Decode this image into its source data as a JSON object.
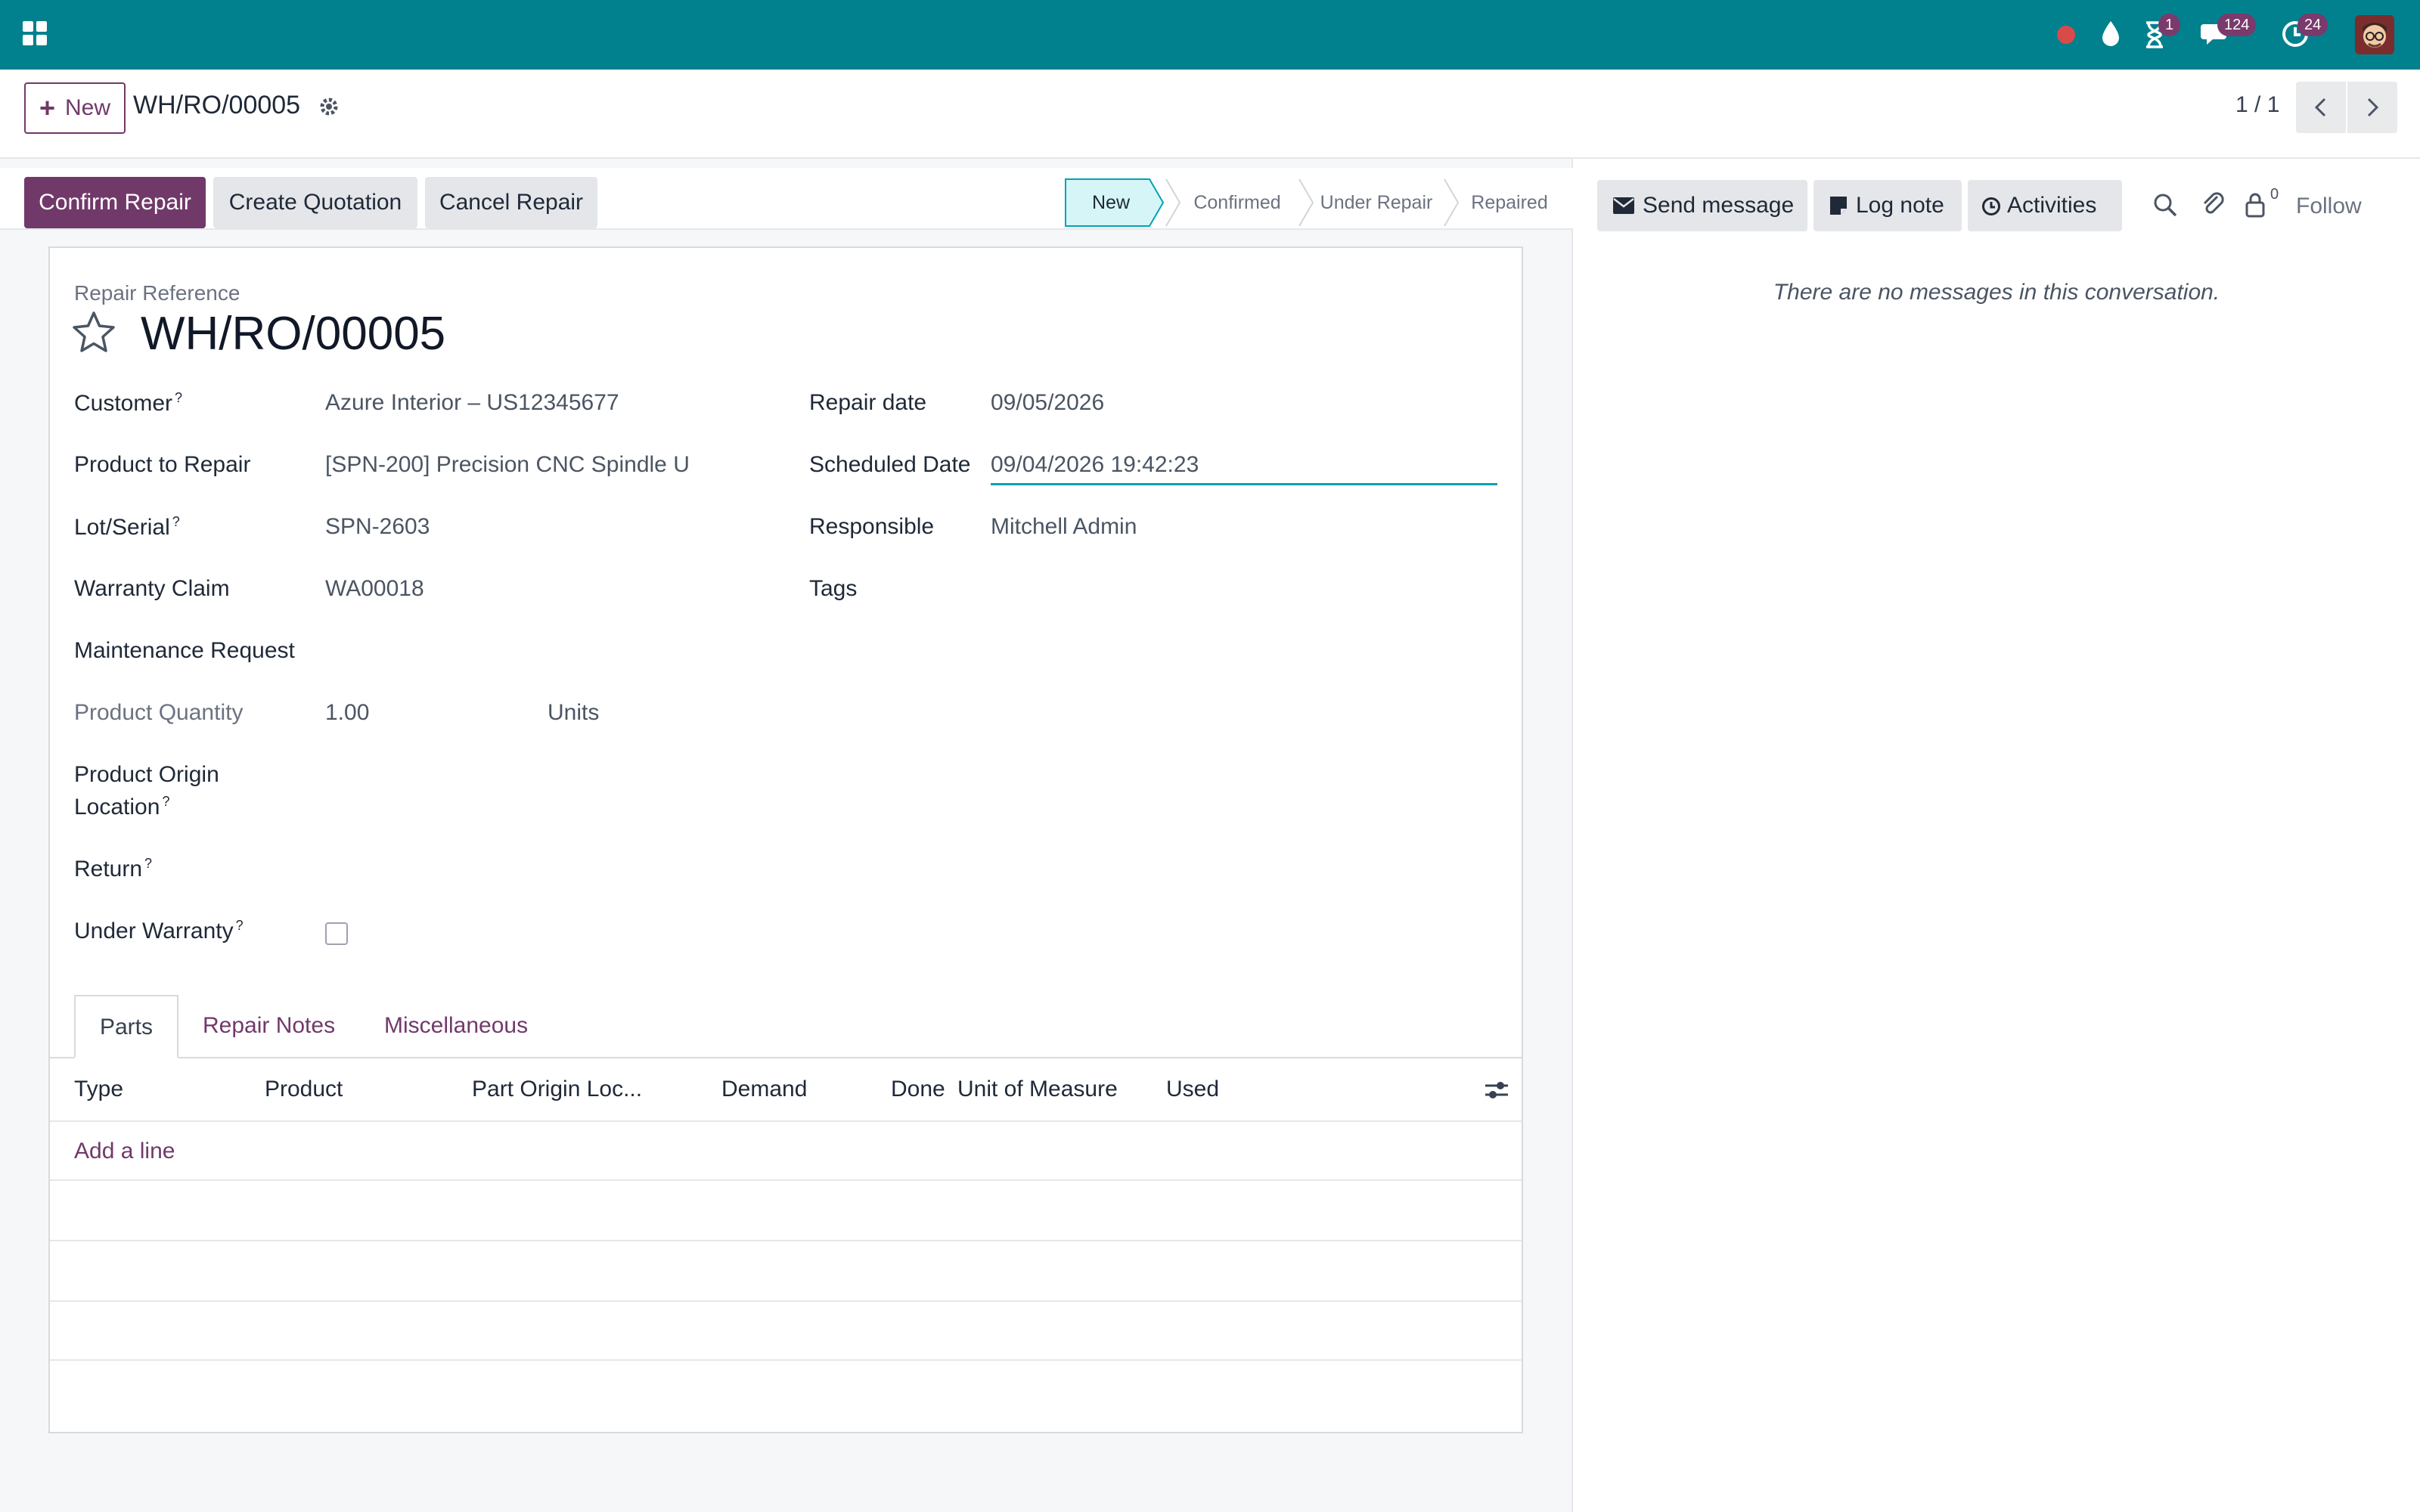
{
  "topbar": {
    "apps_icon": "grid-icon",
    "activity_badge": "1",
    "messages_badge": "124",
    "timer_badge": "24",
    "accent": "#00818d"
  },
  "control_panel": {
    "new_label": "New",
    "record_title": "WH/RO/00005",
    "pager": "1 / 1"
  },
  "actions": {
    "confirm_repair": "Confirm Repair",
    "create_quotation": "Create Quotation",
    "cancel_repair": "Cancel Repair"
  },
  "statusbar": {
    "stages": [
      "New",
      "Confirmed",
      "Under Repair",
      "Repaired"
    ],
    "active": "New"
  },
  "form": {
    "reference_label": "Repair Reference",
    "reference": "WH/RO/00005",
    "left_fields": [
      {
        "label": "Customer",
        "help": "?",
        "value": "Azure Interior – US12345677"
      },
      {
        "label": "Product to Repair",
        "help": "",
        "value": "[SPN-200] Precision CNC Spindle U"
      },
      {
        "label": "Lot/Serial",
        "help": "?",
        "value": "SPN-2603"
      },
      {
        "label": "Warranty Claim",
        "help": "",
        "value": "WA00018"
      },
      {
        "label": "Maintenance Request",
        "help": "",
        "value": ""
      }
    ],
    "quantity": {
      "label": "Product Quantity",
      "value": "1.00",
      "uom": "Units"
    },
    "origin": {
      "label_line1": "Product Origin",
      "label_line2": "Location",
      "help": "?"
    },
    "return": {
      "label": "Return",
      "help": "?"
    },
    "under_warranty": {
      "label": "Under Warranty",
      "help": "?",
      "checked": false
    },
    "right_fields": [
      {
        "label": "Repair date",
        "value": "09/05/2026"
      },
      {
        "label": "Scheduled Date",
        "value": "09/04/2026 19:42:23"
      },
      {
        "label": "Responsible",
        "value": "Mitchell Admin"
      },
      {
        "label": "Tags",
        "value": ""
      }
    ]
  },
  "tabs": [
    "Parts",
    "Repair Notes",
    "Miscellaneous"
  ],
  "parts_table": {
    "columns": [
      "Type",
      "Product",
      "Part Origin Loc...",
      "Demand",
      "Done",
      "Unit of Measure",
      "Used"
    ],
    "add_line": "Add a line"
  },
  "chatter": {
    "send_message": "Send message",
    "log_note": "Log note",
    "activities": "Activities",
    "followers_count": "0",
    "follow": "Follow",
    "empty": "There are no messages in this conversation."
  }
}
